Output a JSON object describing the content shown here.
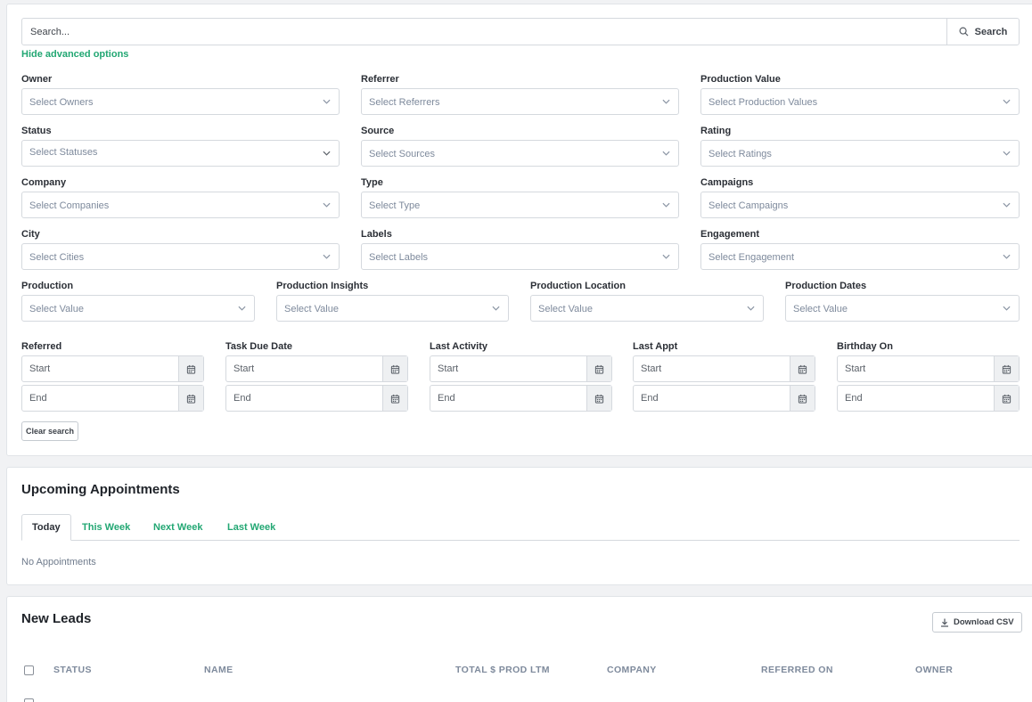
{
  "search": {
    "placeholder": "Search...",
    "button_label": "Search",
    "hide_advanced": "Hide advanced options"
  },
  "filters": {
    "owner": {
      "label": "Owner",
      "placeholder": "Select Owners"
    },
    "referrer": {
      "label": "Referrer",
      "placeholder": "Select Referrers"
    },
    "production_value": {
      "label": "Production Value",
      "placeholder": "Select Production Values"
    },
    "status": {
      "label": "Status",
      "placeholder": "Select Statuses"
    },
    "source": {
      "label": "Source",
      "placeholder": "Select Sources"
    },
    "rating": {
      "label": "Rating",
      "placeholder": "Select Ratings"
    },
    "company": {
      "label": "Company",
      "placeholder": "Select Companies"
    },
    "type": {
      "label": "Type",
      "placeholder": "Select Type"
    },
    "campaigns": {
      "label": "Campaigns",
      "placeholder": "Select Campaigns"
    },
    "city": {
      "label": "City",
      "placeholder": "Select Cities"
    },
    "labels": {
      "label": "Labels",
      "placeholder": "Select Labels"
    },
    "engagement": {
      "label": "Engagement",
      "placeholder": "Select Engagement"
    },
    "production": {
      "label": "Production",
      "placeholder": "Select Value"
    },
    "production_insights": {
      "label": "Production Insights",
      "placeholder": "Select Value"
    },
    "production_location": {
      "label": "Production Location",
      "placeholder": "Select Value"
    },
    "production_dates": {
      "label": "Production Dates",
      "placeholder": "Select Value"
    }
  },
  "date_filters": [
    {
      "label": "Referred",
      "start": "Start",
      "end": "End"
    },
    {
      "label": "Task Due Date",
      "start": "Start",
      "end": "End"
    },
    {
      "label": "Last Activity",
      "start": "Start",
      "end": "End"
    },
    {
      "label": "Last Appt",
      "start": "Start",
      "end": "End"
    },
    {
      "label": "Birthday On",
      "start": "Start",
      "end": "End"
    }
  ],
  "clear_search": "Clear search",
  "appointments": {
    "title": "Upcoming Appointments",
    "tabs": [
      "Today",
      "This Week",
      "Next Week",
      "Last Week"
    ],
    "active_tab": "Today",
    "empty_text": "No Appointments"
  },
  "leads": {
    "title": "New Leads",
    "download_csv": "Download CSV",
    "columns": [
      "STATUS",
      "NAME",
      "TOTAL $ PROD LTM",
      "COMPANY",
      "REFERRED ON",
      "OWNER"
    ]
  },
  "colors": {
    "accent": "#22a773",
    "muted": "#7e8a9c",
    "border": "#d5d9de"
  }
}
